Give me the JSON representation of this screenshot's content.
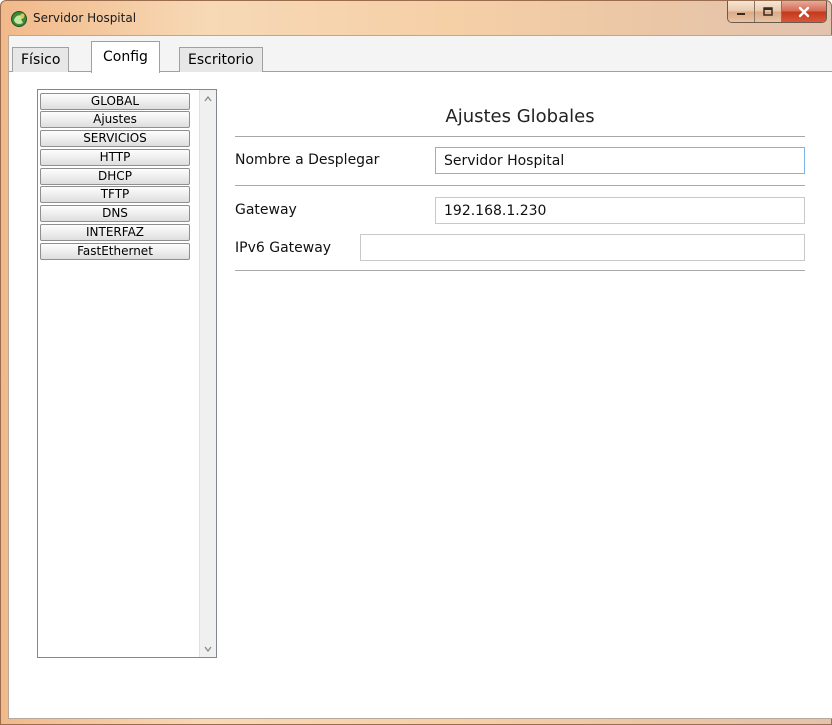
{
  "window": {
    "title": "Servidor Hospital",
    "app_icon": "packet-tracer-icon"
  },
  "tabs": [
    {
      "label": "Físico",
      "active": false
    },
    {
      "label": "Config",
      "active": true
    },
    {
      "label": "Escritorio",
      "active": false
    }
  ],
  "sidebar": {
    "items": [
      {
        "label": "GLOBAL"
      },
      {
        "label": "Ajustes"
      },
      {
        "label": "SERVICIOS"
      },
      {
        "label": "HTTP"
      },
      {
        "label": "DHCP"
      },
      {
        "label": "TFTP"
      },
      {
        "label": "DNS"
      },
      {
        "label": "INTERFAZ"
      },
      {
        "label": "FastEthernet"
      }
    ]
  },
  "settings": {
    "title": "Ajustes Globales",
    "display_name": {
      "label": "Nombre a Desplegar",
      "value": "Servidor Hospital"
    },
    "gateway": {
      "label": "Gateway",
      "value": "192.168.1.230"
    },
    "ipv6_gateway": {
      "label": "IPv6 Gateway",
      "value": ""
    }
  },
  "colors": {
    "titlebar_accent": "#f5cfa6",
    "close_button": "#c2391c",
    "focus_border": "#7eb4ea"
  }
}
